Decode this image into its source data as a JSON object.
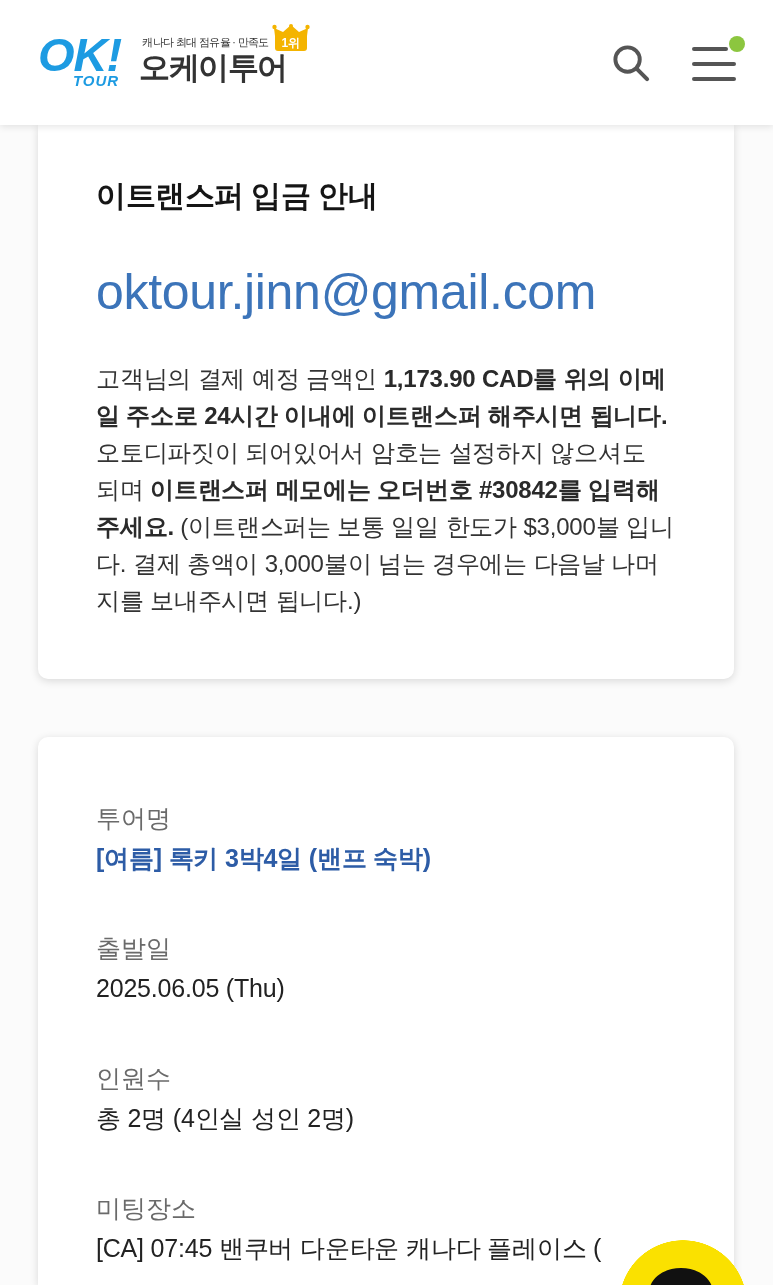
{
  "header": {
    "logo_mark": "OK!",
    "logo_sub": "TOUR",
    "tagline": "캐나다 최대 점유율 · 만족도",
    "rank_badge": "1위",
    "brand_name": "오케이투어",
    "notification_dot": true
  },
  "payment_notice": {
    "title": "이트랜스퍼 입금 안내",
    "email": "oktour.jinn@gmail.com",
    "body": "고객님의 결제 예정 금액인 **1,173.90 CAD를 위의 이메일 주소로 24시간 이내에 이트랜스퍼 해주시면 됩니다.** 오토디파짓이 되어있어서 암호는 설정하지 않으셔도 되며 **이트랜스퍼 메모에는 오더번호 #30842를 입력해 주세요.** (이트랜스퍼는 보통 일일 한도가 $3,000불 입니다. 결제 총액이 3,000불이 넘는 경우에는 다음날 나머지를 보내주시면 됩니다.)"
  },
  "tour_details": {
    "fields": [
      {
        "label": "투어명",
        "value": "[여름] 록키 3박4일 (밴프 숙박)",
        "kind": "link"
      },
      {
        "label": "출발일",
        "value": "2025.06.05 (Thu)",
        "kind": "text"
      },
      {
        "label": "인원수",
        "value": "총 2명 (4인실 성인 2명)",
        "kind": "text"
      },
      {
        "label": "미팅장소",
        "value": "[CA] 07:45 밴쿠버 다운타운 캐나다 플레이스 (",
        "kind": "text"
      }
    ]
  }
}
